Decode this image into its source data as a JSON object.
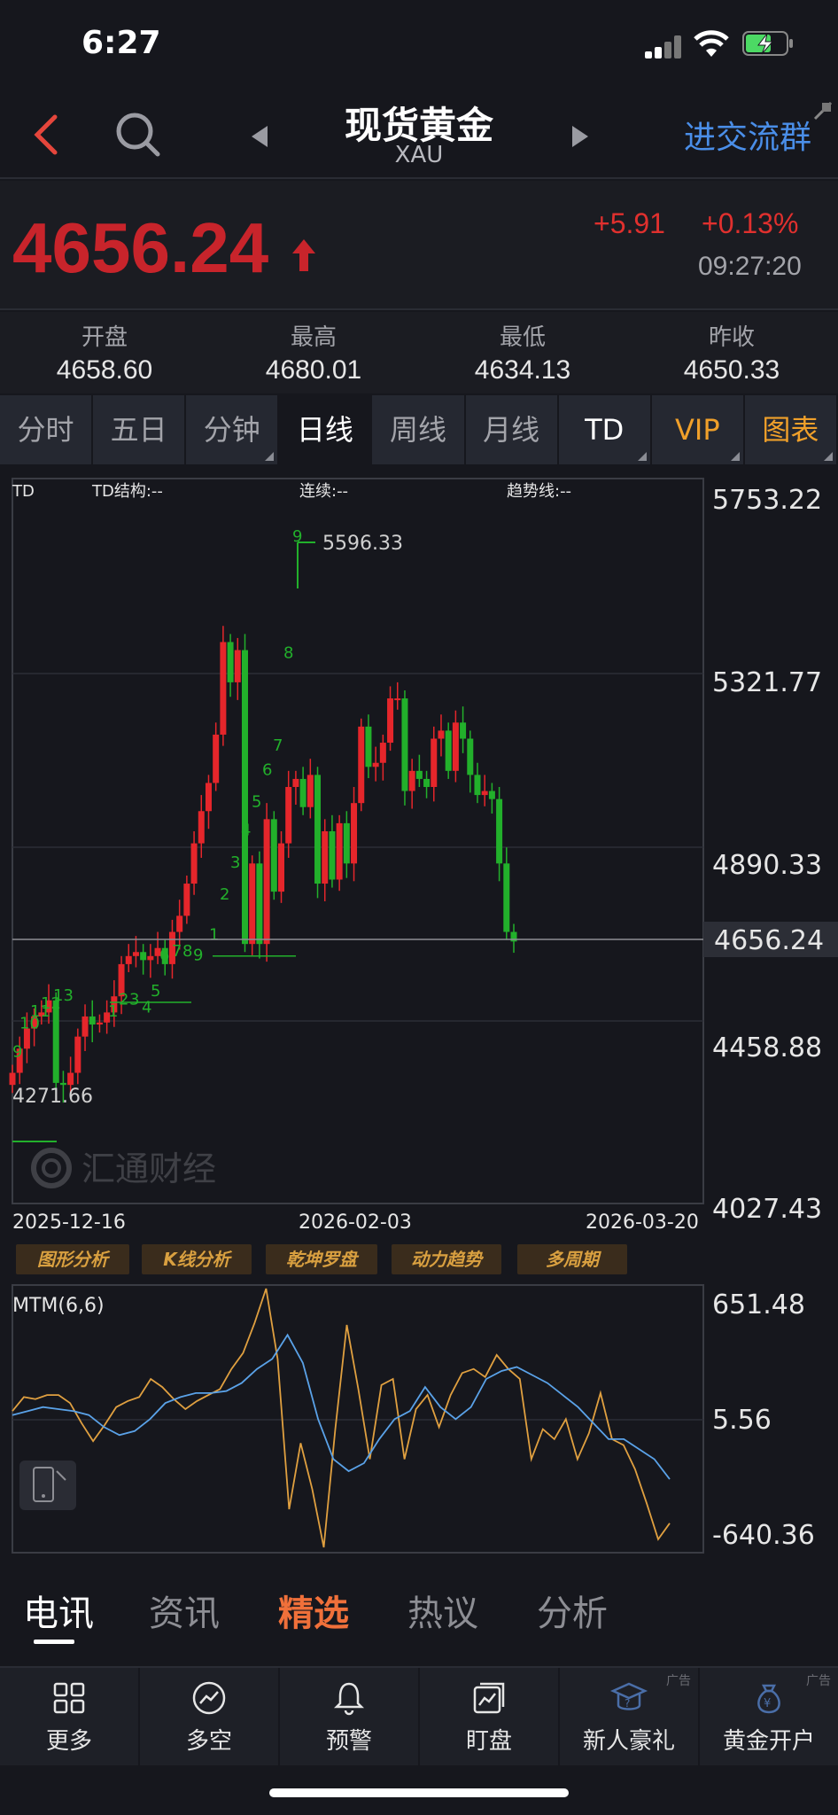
{
  "status": {
    "time": "6:27"
  },
  "nav": {
    "title": "现货黄金",
    "subtitle": "XAU",
    "group_link": "进交流群"
  },
  "quote": {
    "price": "4656.24",
    "change": "+5.91",
    "change_pct": "+0.13%",
    "time": "09:27:20",
    "price_color": "#c8242b"
  },
  "stats": [
    {
      "label": "开盘",
      "value": "4658.60"
    },
    {
      "label": "最高",
      "value": "4680.01"
    },
    {
      "label": "最低",
      "value": "4634.13"
    },
    {
      "label": "昨收",
      "value": "4650.33"
    }
  ],
  "period_tabs": [
    {
      "label": "分时"
    },
    {
      "label": "五日"
    },
    {
      "label": "分钟"
    },
    {
      "label": "日线"
    },
    {
      "label": "周线"
    },
    {
      "label": "月线"
    },
    {
      "label": "TD"
    },
    {
      "label": "VIP"
    },
    {
      "label": "图表"
    }
  ],
  "chart": {
    "headers": {
      "td": "TD",
      "structure": "TD结构:--",
      "continuous": "连续:--",
      "trendline": "趋势线:--"
    },
    "watermark": "汇通财经",
    "y_labels": [
      "5753.22",
      "5321.77",
      "4890.33",
      "4656.24",
      "4458.88",
      "4027.43"
    ],
    "x_labels": [
      "2025-12-16",
      "2026-02-03",
      "2026-03-20"
    ],
    "high_label": "5596.33",
    "low_label": "4271.66",
    "up_color": "#e5262b",
    "down_color": "#22b02b"
  },
  "analysis_buttons": [
    "图形分析",
    "K线分析",
    "乾坤罗盘",
    "动力趋势",
    "多周期"
  ],
  "indicator": {
    "name": "MTM(6,6)",
    "y_labels": [
      "651.48",
      "5.56",
      "-640.36"
    ]
  },
  "chart_data": {
    "type": "candlestick",
    "x_start": "2025-12-16",
    "x_end": "2026-03-20",
    "ylim": [
      4027.43,
      5753.22
    ],
    "current": 4656.24,
    "high": 5596.33,
    "low": 4271.66,
    "close": [
      4330,
      4390,
      4440,
      4470,
      4480,
      4510,
      4305,
      4300,
      4330,
      4420,
      4470,
      4450,
      4455,
      4480,
      4520,
      4600,
      4620,
      4630,
      4610,
      4620,
      4640,
      4600,
      4680,
      4720,
      4800,
      4900,
      4980,
      5050,
      5170,
      5400,
      5300,
      5380,
      4650,
      4850,
      4650,
      4960,
      4780,
      4900,
      5040,
      5060,
      4990,
      5070,
      4800,
      4930,
      4810,
      4950,
      4850,
      5000,
      5190,
      5090,
      5100,
      5150,
      5260,
      5260,
      5030,
      5080,
      5060,
      5040,
      5160,
      5180,
      5080,
      5200,
      5160,
      5070,
      5020,
      5030,
      5010,
      4850,
      4680,
      4656.24
    ],
    "mtm": [
      40,
      110,
      100,
      120,
      120,
      80,
      -20,
      -110,
      -30,
      60,
      90,
      110,
      200,
      160,
      100,
      50,
      90,
      120,
      150,
      250,
      330,
      480,
      651.48,
      300,
      -450,
      -120,
      -350,
      -640.36,
      -50,
      470,
      150,
      -200,
      170,
      200,
      -200,
      50,
      120,
      -40,
      120,
      230,
      250,
      210,
      320,
      250,
      200,
      -200,
      -50,
      -100,
      0,
      -200,
      -70,
      130,
      -100,
      -130,
      -250,
      -420,
      -600,
      -520
    ],
    "mtm_ma": [
      20,
      40,
      60,
      50,
      40,
      20,
      -40,
      -80,
      -60,
      0,
      80,
      110,
      130,
      130,
      140,
      180,
      250,
      300,
      420,
      280,
      0,
      -200,
      -260,
      -220,
      -100,
      0,
      40,
      160,
      60,
      0,
      60,
      200,
      240,
      260,
      220,
      180,
      120,
      60,
      -20,
      -100,
      -100,
      -150,
      -200,
      -300
    ]
  }
}
